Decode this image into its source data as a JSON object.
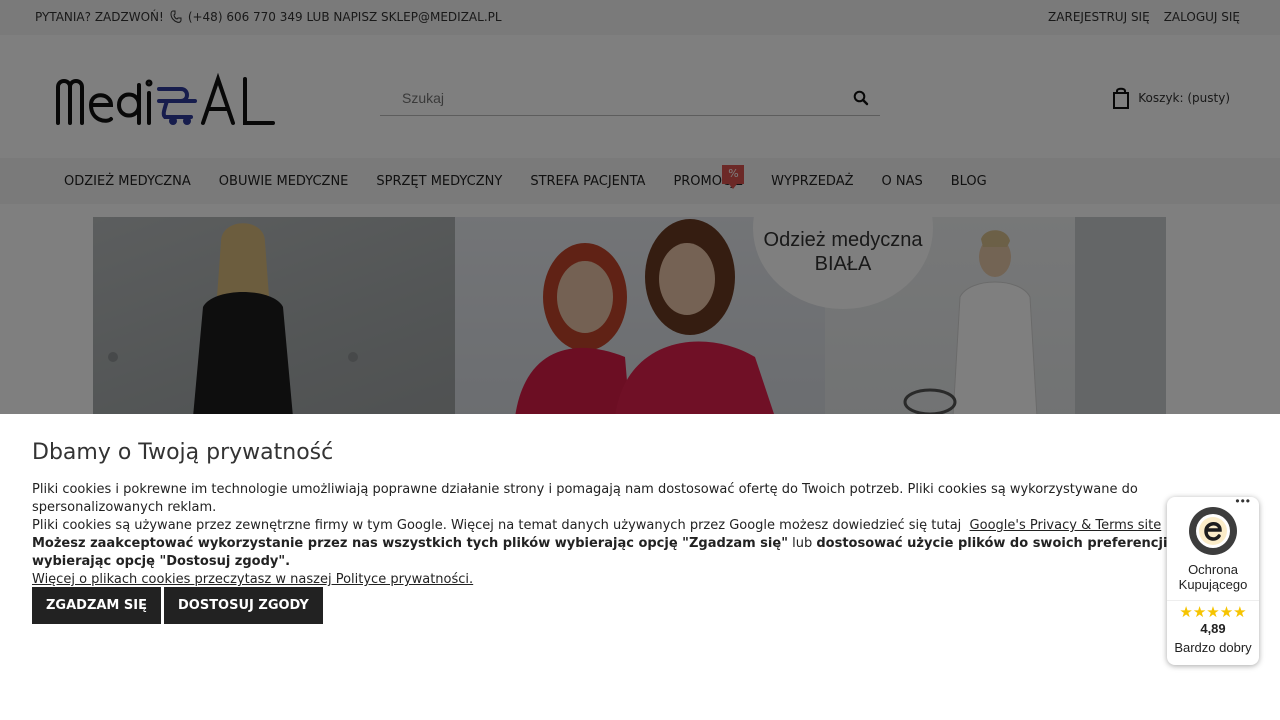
{
  "topbar": {
    "question": "PYTANIA? ZADZWOŃ!",
    "contact": "(+48) 606 770 349 LUB NAPISZ SKLEP@MEDIZAL.PL",
    "register": "ZAREJESTRUJ SIĘ",
    "login": "ZALOGUJ SIĘ"
  },
  "search": {
    "placeholder": "Szukaj"
  },
  "cart": {
    "label": "Koszyk: (pusty)"
  },
  "nav": {
    "items": [
      "ODZIEŻ MEDYCZNA",
      "OBUWIE MEDYCZNE",
      "SPRZĘT MEDYCZNY",
      "STREFA PACJENTA",
      "PROMOCJE",
      "WYPRZEDAŻ",
      "O NAS",
      "BLOG"
    ],
    "promo_badge": "%"
  },
  "banner": {
    "line1": "Odzież medyczna",
    "line2": "BIAŁA"
  },
  "cookie": {
    "title": "Dbamy o Twoją prywatność",
    "p1": "Pliki cookies i pokrewne im technologie umożliwiają poprawne działanie strony i pomagają nam dostosować ofertę do Twoich potrzeb. Pliki cookies są wykorzystywane do spersonalizowanych reklam.",
    "p2_text": "Pliki cookies są używane przez zewnętrzne firmy w tym Google. Więcej na temat danych używanych przez Google możesz dowiedzieć się tutaj",
    "p2_link": "Google's Privacy & Terms site",
    "p3_bold1": "Możesz zaakceptować wykorzystanie przez nas wszystkich tych plików wybierając opcję \"Zgadzam się\"",
    "p3_mid": " lub ",
    "p3_bold2": "dostosować użycie plików do swoich preferencji, wybierając opcję \"Dostosuj zgody\".",
    "policy_link": "Więcej o plikach cookies przeczytasz w naszej Polityce prywatności.",
    "accept": "ZGADZAM SIĘ",
    "customize": "DOSTOSUJ ZGODY"
  },
  "trust": {
    "more": "•••",
    "title": "Ochrona Kupującego",
    "stars": "★★★★★",
    "score": "4,89",
    "rating": "Bardzo dobry"
  },
  "colors": {
    "accent": "#1f2a8a",
    "badge": "#d9534f",
    "button": "#222222",
    "star": "#f6c400"
  }
}
